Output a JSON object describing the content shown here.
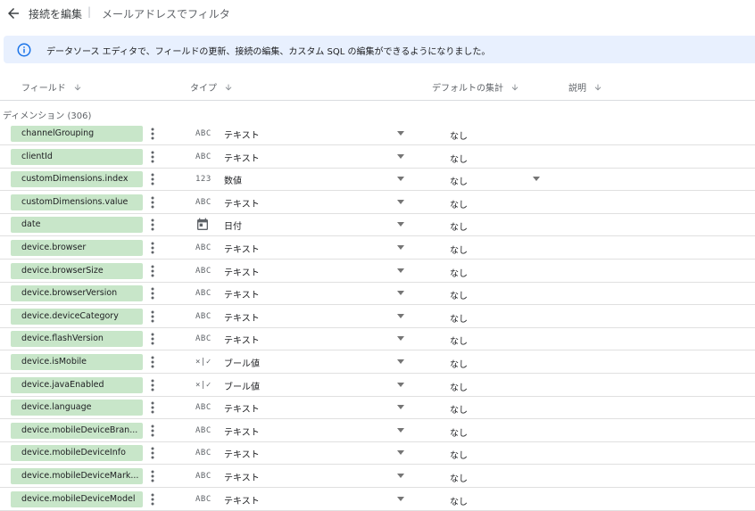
{
  "topbar": {
    "back_label": "接続を編集",
    "separator": "|",
    "title": "メールアドレスでフィルタ"
  },
  "banner": {
    "message": "データソース エディタで、フィールドの更新、接続の編集、カスタム SQL の編集ができるようになりました。"
  },
  "columns": {
    "field": "フィールド",
    "type": "タイプ",
    "default_agg": "デフォルトの集計",
    "description": "説明"
  },
  "section": {
    "label": "ディメンション (306)"
  },
  "icons": {
    "back": "arrow-left-icon",
    "info": "info-icon",
    "sort": "arrow-down-icon",
    "menu": "kebab-icon",
    "dropdown": "caret-down-icon",
    "date": "calendar-icon"
  },
  "colors": {
    "chip": "#c8e6c9",
    "banner": "#e8f0fe",
    "info": "#1a73e8"
  },
  "rows": [
    {
      "field": "channelGrouping",
      "type_icon": "ABC",
      "type": "テキスト",
      "agg": "なし"
    },
    {
      "field": "clientId",
      "type_icon": "ABC",
      "type": "テキスト",
      "agg": "なし"
    },
    {
      "field": "customDimensions.index",
      "type_icon": "123",
      "type": "数値",
      "agg": "なし"
    },
    {
      "field": "customDimensions.value",
      "type_icon": "ABC",
      "type": "テキスト",
      "agg": "なし"
    },
    {
      "field": "date",
      "type_icon": "CAL",
      "type": "日付",
      "agg": "なし"
    },
    {
      "field": "device.browser",
      "type_icon": "ABC",
      "type": "テキスト",
      "agg": "なし"
    },
    {
      "field": "device.browserSize",
      "type_icon": "ABC",
      "type": "テキスト",
      "agg": "なし"
    },
    {
      "field": "device.browserVersion",
      "type_icon": "ABC",
      "type": "テキスト",
      "agg": "なし"
    },
    {
      "field": "device.deviceCategory",
      "type_icon": "ABC",
      "type": "テキスト",
      "agg": "なし"
    },
    {
      "field": "device.flashVersion",
      "type_icon": "ABC",
      "type": "テキスト",
      "agg": "なし"
    },
    {
      "field": "device.isMobile",
      "type_icon": "×|✓",
      "type": "ブール値",
      "agg": "なし"
    },
    {
      "field": "device.javaEnabled",
      "type_icon": "×|✓",
      "type": "ブール値",
      "agg": "なし"
    },
    {
      "field": "device.language",
      "type_icon": "ABC",
      "type": "テキスト",
      "agg": "なし"
    },
    {
      "field": "device.mobileDeviceBran...",
      "type_icon": "ABC",
      "type": "テキスト",
      "agg": "なし"
    },
    {
      "field": "device.mobileDeviceInfo",
      "type_icon": "ABC",
      "type": "テキスト",
      "agg": "なし"
    },
    {
      "field": "device.mobileDeviceMark...",
      "type_icon": "ABC",
      "type": "テキスト",
      "agg": "なし"
    },
    {
      "field": "device.mobileDeviceModel",
      "type_icon": "ABC",
      "type": "テキスト",
      "agg": "なし"
    }
  ]
}
